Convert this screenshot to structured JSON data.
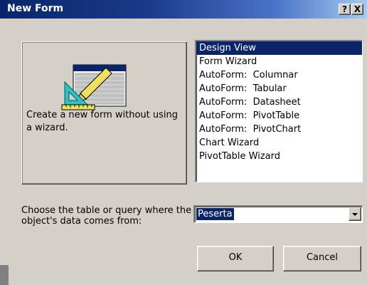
{
  "window": {
    "title": "New Form",
    "help_button": "?",
    "close_button": "X"
  },
  "preview": {
    "icon": "form-design-icon",
    "description": "Create a new form without using a wizard."
  },
  "list": {
    "items": [
      {
        "label": "Design View",
        "selected": true
      },
      {
        "label": "Form Wizard",
        "selected": false
      },
      {
        "label": "AutoForm:  Columnar",
        "selected": false
      },
      {
        "label": "AutoForm:  Tabular",
        "selected": false
      },
      {
        "label": "AutoForm:  Datasheet",
        "selected": false
      },
      {
        "label": "AutoForm:  PivotTable",
        "selected": false
      },
      {
        "label": "AutoForm:  PivotChart",
        "selected": false
      },
      {
        "label": "Chart Wizard",
        "selected": false
      },
      {
        "label": "PivotTable Wizard",
        "selected": false
      }
    ]
  },
  "source": {
    "label": "Choose the table or query where the object's data comes from:",
    "value": "Peserta"
  },
  "buttons": {
    "ok": "OK",
    "cancel": "Cancel"
  },
  "colors": {
    "title_start": "#0a246a",
    "title_end": "#a6caf0",
    "face": "#d4d0c8",
    "selection": "#0a246a"
  }
}
